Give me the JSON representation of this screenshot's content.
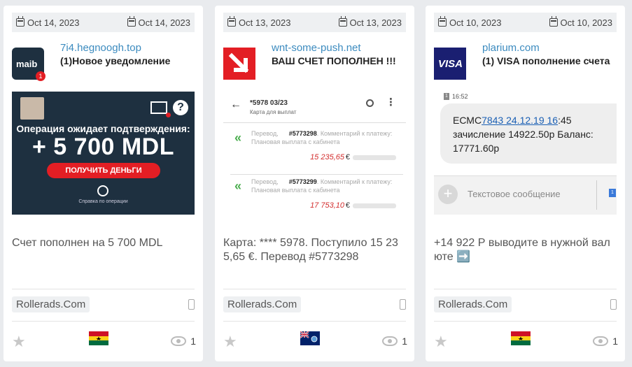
{
  "cards": [
    {
      "date_first": "Oct 14, 2023",
      "date_last": "Oct 14, 2023",
      "domain": "7i4.hegnoogh.top",
      "title": "(1)Новое уведомление",
      "logo_text": "maib",
      "logo_badge": "1",
      "creative": {
        "headline": "Операция ожидает подтверждения:",
        "amount": "+ 5 700 MDL",
        "button": "ПОЛУЧИТЬ ДЕНЬГИ",
        "help": "?",
        "footer": "Справка по операции"
      },
      "description": "Счет пополнен на 5 700 MDL",
      "network": "Rollerads.Com",
      "views": "1",
      "flag": "ghana-flag"
    },
    {
      "date_first": "Oct 13, 2023",
      "date_last": "Oct 13, 2023",
      "domain": "wnt-some-push.net",
      "title": "ВАШ СЧЕТ ПОПОЛНЕН !!!",
      "creative": {
        "back": "←",
        "card_title": "*5978 03/23",
        "card_subtitle": "Карта для выплат",
        "rows": [
          {
            "prefix": "Перевод,",
            "number": "#5773298",
            "comment": "Комментарий к платежу: Плановая выплата с кабинета",
            "amount": "15 235,65",
            "currency": "€"
          },
          {
            "prefix": "Перевод,",
            "number": "#5773299",
            "comment": "Комментарий к платежу: Плановая выплата с кабинета",
            "amount": "17 753,10",
            "currency": "€"
          }
        ]
      },
      "description": "Карта: **** 5978. Поступило 15 235,65 €. Перевод #5773298",
      "network": "Rollerads.Com",
      "views": "1",
      "flag": "falkland-islands-flag"
    },
    {
      "date_first": "Oct 10, 2023",
      "date_last": "Oct 10, 2023",
      "domain": "plarium.com",
      "title": "(1) VISA пополнение счета",
      "logo_text": "VISA",
      "creative": {
        "sim": "1",
        "time": "16:52",
        "msg_prefix": "ЕСМС",
        "msg_link": "7843 24.12.19 16",
        "msg_rest": ":45 зачисление 14922.50р Баланс: 17771.60р",
        "input_placeholder": "Текстовое сообщение",
        "send_sim": "1"
      },
      "description": "+14 922 Р выводите в нужной валюте ➡️",
      "network": "Rollerads.Com",
      "views": "1",
      "flag": "ghana-flag"
    }
  ],
  "colors": {
    "accent": "#3c8bbf",
    "maib": "#1e3040",
    "visa": "#1a1f71",
    "red": "#e31e24"
  }
}
